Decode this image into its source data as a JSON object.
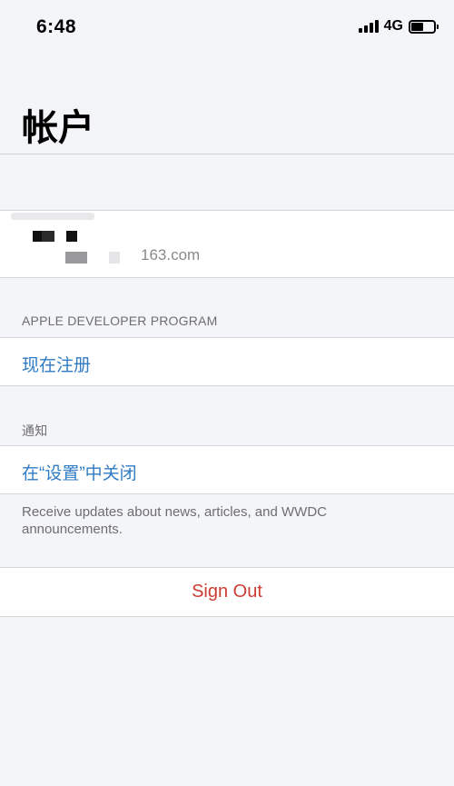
{
  "status_bar": {
    "time": "6:48",
    "network": "4G",
    "battery_level": 0.55
  },
  "page": {
    "title": "帐户"
  },
  "account": {
    "email_suffix": "163.com"
  },
  "developer_program": {
    "header": "APPLE DEVELOPER PROGRAM",
    "enroll_label": "现在注册"
  },
  "notifications": {
    "header": "通知",
    "settings_label": "在“设置”中关闭",
    "footer": "Receive updates about news, articles, and WWDC announcements."
  },
  "sign_out": {
    "label": "Sign Out"
  },
  "colors": {
    "link": "#2f7bc4",
    "destructive": "#cc3d33",
    "background": "#f4f5f8"
  },
  "icons": [
    "cellular-signal-icon",
    "battery-icon"
  ]
}
